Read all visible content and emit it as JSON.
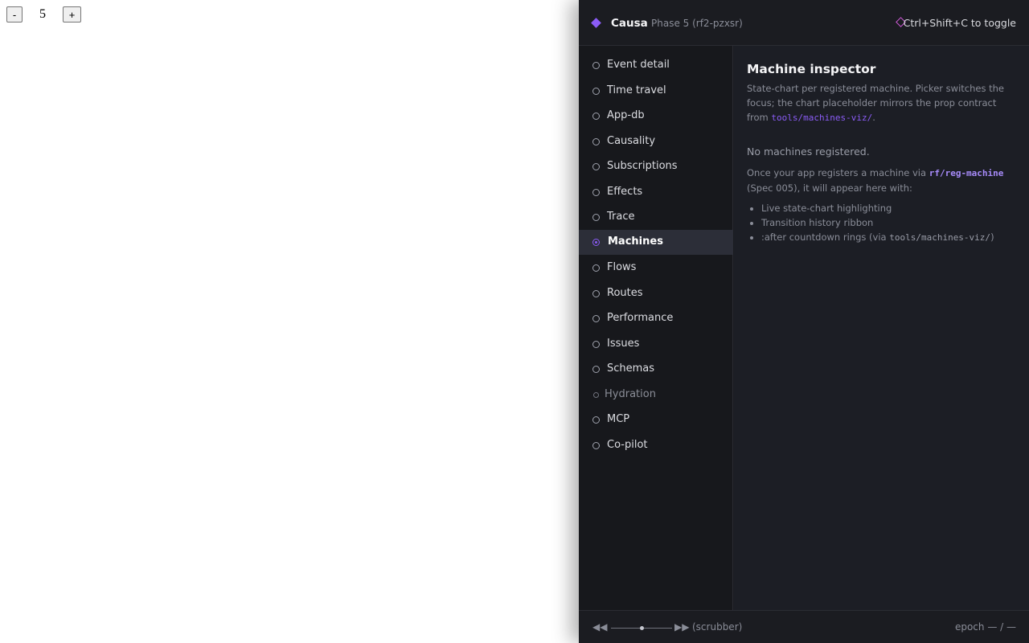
{
  "host": {
    "decrement_label": "-",
    "count": "5",
    "increment_label": "+"
  },
  "panel": {
    "header": {
      "brand_icon": "diamond-icon",
      "brand": "Causa",
      "phase": "Phase 5 (rf2-pzxsr)",
      "toggle_icon": "diamond-outline-icon",
      "toggle_hint": "Ctrl+Shift+C to toggle"
    },
    "sidebar": {
      "items": [
        {
          "label": "Event detail"
        },
        {
          "label": "Time travel"
        },
        {
          "label": "App-db"
        },
        {
          "label": "Causality"
        },
        {
          "label": "Subscriptions"
        },
        {
          "label": "Effects"
        },
        {
          "label": "Trace"
        },
        {
          "label": "Machines",
          "active": true
        },
        {
          "label": "Flows"
        },
        {
          "label": "Routes"
        },
        {
          "label": "Performance"
        },
        {
          "label": "Issues"
        },
        {
          "label": "Schemas"
        },
        {
          "label": "Hydration",
          "dim": true
        },
        {
          "label": "MCP"
        },
        {
          "label": "Co-pilot"
        }
      ]
    },
    "main": {
      "title": "Machine inspector",
      "desc": "State-chart per registered machine. Picker switches the focus; the chart placeholder mirrors the prop contract from",
      "desc_code": "tools/machines-viz/",
      "desc_end": ".",
      "empty_title": "No machines registered.",
      "empty_body_pre": "Once your app registers a machine via",
      "empty_body_code": "rf/reg-machine",
      "empty_body_post": "(Spec 005), it will appear here with:",
      "features": [
        "Live state-chart highlighting",
        "Transition history ribbon"
      ],
      "feature3_pre": ":after countdown rings (via",
      "feature3_code": "tools/machines-viz/",
      "feature3_post": ")"
    },
    "footer": {
      "prev_glyph": "◀◀",
      "next_glyph": "▶▶",
      "scrubber_label": "(scrubber)",
      "scrubber_position": 0.5,
      "epoch": "epoch — / —"
    },
    "colors": {
      "accent": "#8b5cf6",
      "toggle_accent": "#d05ad8",
      "panel_bg": "#1b1c21"
    }
  }
}
